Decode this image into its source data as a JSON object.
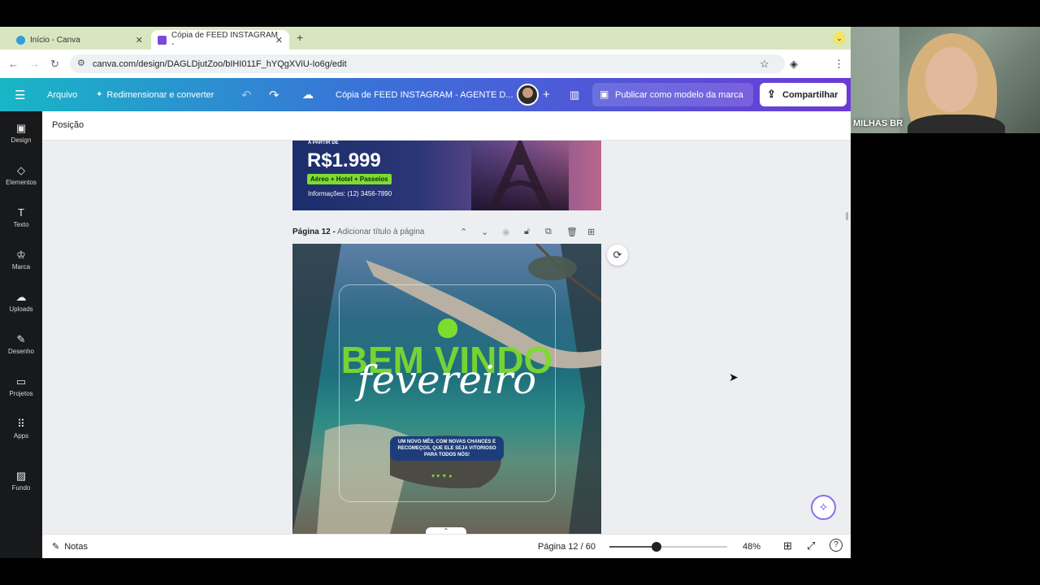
{
  "browser": {
    "tabs": [
      {
        "label": "Início - Canva"
      },
      {
        "label": "Cópia de FEED INSTAGRAM -"
      }
    ],
    "new_tab": "+",
    "url": "canva.com/design/DAGLDjutZoo/bIHI011F_hYQgXViU-Io6g/edit"
  },
  "header": {
    "file": "Arquivo",
    "resize": "Redimensionar e converter",
    "doc_title": "Cópia de FEED INSTAGRAM - AGENTE D...",
    "publish": "Publicar como modelo da marca",
    "share": "Compartilhar"
  },
  "sidebar": {
    "items": [
      {
        "label": "Design",
        "icon": "design-icon"
      },
      {
        "label": "Elementos",
        "icon": "elements-icon"
      },
      {
        "label": "Texto",
        "icon": "text-icon"
      },
      {
        "label": "Marca",
        "icon": "brand-icon"
      },
      {
        "label": "Uploads",
        "icon": "uploads-icon"
      },
      {
        "label": "Desenho",
        "icon": "draw-icon"
      },
      {
        "label": "Projetos",
        "icon": "folder-icon"
      },
      {
        "label": "Apps",
        "icon": "apps-icon"
      },
      {
        "label": "Fundo",
        "icon": "background-icon"
      }
    ]
  },
  "toolbar": {
    "position": "Posição"
  },
  "page11": {
    "from": "A PARTIR DE",
    "price": "R$1.999",
    "package": "Aéreo + Hotel + Passeios",
    "info": "Informações: (12) 3456-7890"
  },
  "page12": {
    "label": "Página 12 -",
    "add_title": "Adicionar título à página",
    "big_text": "BEM VINDO",
    "script_text": "fevereiro",
    "message": "UM NOVO MÊS, COM NOVAS CHANCES E RECOMEÇOS, QUE ELE SEJA VITORIOSO PARA TODOS NÓS!"
  },
  "footer": {
    "notes": "Notas",
    "page_indicator": "Página 12 / 60",
    "zoom": "48%",
    "zoom_fraction": 0.4
  },
  "webcam": {
    "name": "MILHAS BR"
  },
  "colors": {
    "header_start": "#19b6c6",
    "header_end": "#6b3ad6",
    "accent_green": "#7ddc2e"
  }
}
